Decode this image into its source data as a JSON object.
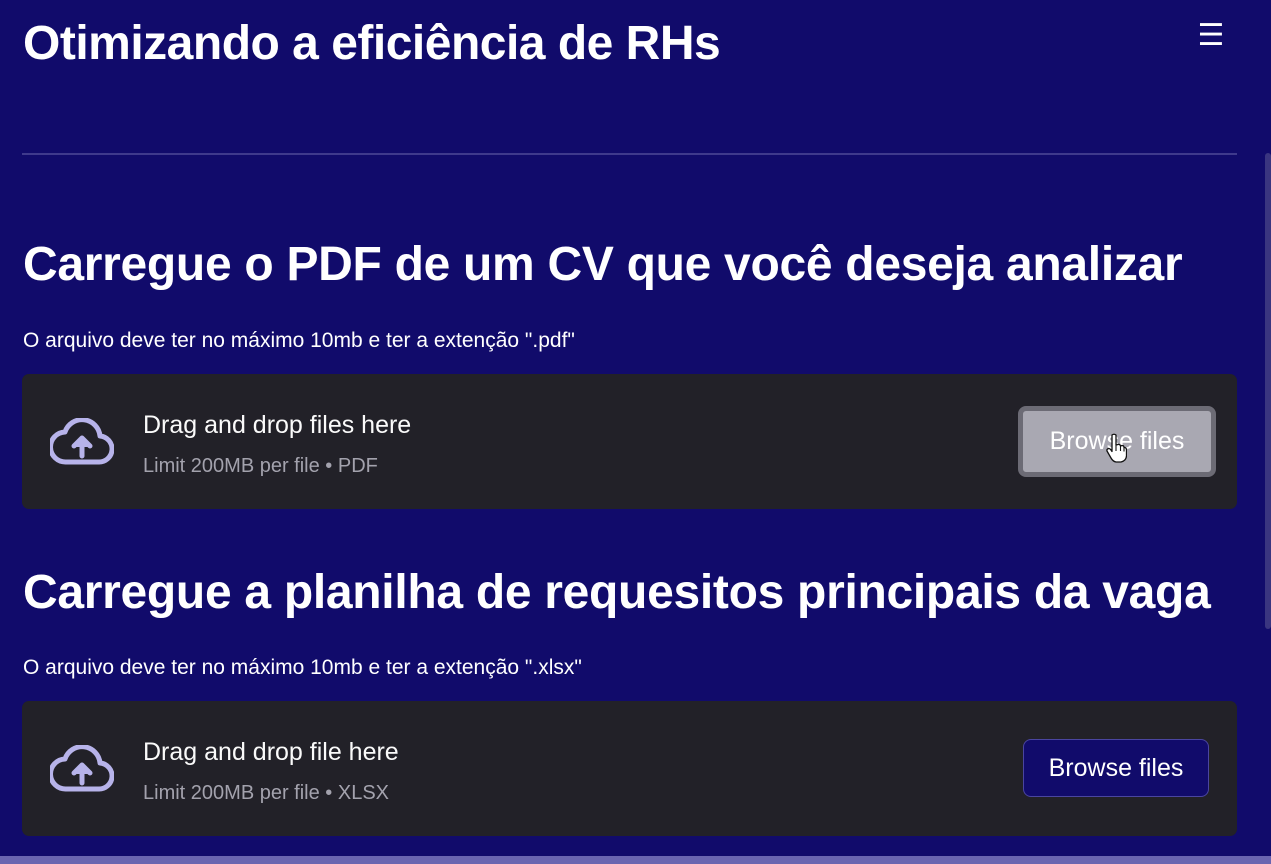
{
  "header": {
    "title": "Otimizando a eficiência de RHs",
    "menu_icon": "☰"
  },
  "sections": [
    {
      "heading": "Carregue o PDF de um CV que você deseja analizar",
      "note": "O arquivo deve ter no máximo 10mb e ter a extenção \".pdf\"",
      "uploader": {
        "title": "Drag and drop files here",
        "limit": "Limit 200MB per file • PDF",
        "button_label": "Browse files",
        "button_state": "hovered"
      }
    },
    {
      "heading": "Carregue a planilha de requesitos principais da vaga",
      "note": "O arquivo deve ter no máximo 10mb e ter a extenção \".xlsx\"",
      "uploader": {
        "title": "Drag and drop file here",
        "limit": "Limit 200MB per file • XLSX",
        "button_label": "Browse files",
        "button_state": "normal"
      }
    }
  ],
  "icons": {
    "upload": "cloud-upload-icon",
    "menu": "hamburger-menu-icon",
    "cursor": "hand-pointer-cursor-icon"
  },
  "colors": {
    "background": "#110b6b",
    "dropzone": "#222128",
    "upload_icon": "#b7b3ea",
    "divider": "#3f3a8c"
  }
}
